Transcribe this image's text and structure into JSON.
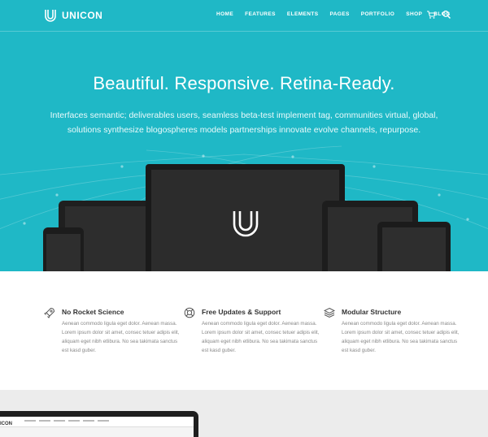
{
  "brand": {
    "name": "UNICON"
  },
  "nav": {
    "items": [
      "HOME",
      "FEATURES",
      "ELEMENTS",
      "PAGES",
      "PORTFOLIO",
      "SHOP",
      "BLOG"
    ],
    "icons": [
      "cart-icon",
      "search-icon"
    ]
  },
  "hero": {
    "headline": "Beautiful. Responsive. Retina-Ready.",
    "subtext": "Interfaces semantic; deliverables users, seamless beta-test implement tag, communities virtual, global, solutions synthesize blogospheres models partnerships innovate evolve channels, repurpose.",
    "background_color": "#1fb8c6"
  },
  "features": [
    {
      "icon": "rocket-icon",
      "title": "No Rocket Science",
      "text": "Aenean commodo ligula eget dolor. Aenean massa. Lorem ipsum dolor sit amet, consec tetuer adipis elit, aliquam eget nibh etlibura. No sea takimata sanctus est kasd guber."
    },
    {
      "icon": "lifebuoy-icon",
      "title": "Free Updates & Support",
      "text": "Aenean commodo ligula eget dolor. Aenean massa. Lorem ipsum dolor sit amet, consec tetuer adipis elit, aliquam eget nibh etlibura. No sea takimata sanctus est kasd guber."
    },
    {
      "icon": "layers-icon",
      "title": "Modular Structure",
      "text": "Aenean commodo ligula eget dolor. Aenean massa. Lorem ipsum dolor sit amet, consec tetuer adipis elit, aliquam eget nibh etlibura. No sea takimata sanctus est kasd guber."
    }
  ],
  "preview": {
    "label": "ICON"
  }
}
